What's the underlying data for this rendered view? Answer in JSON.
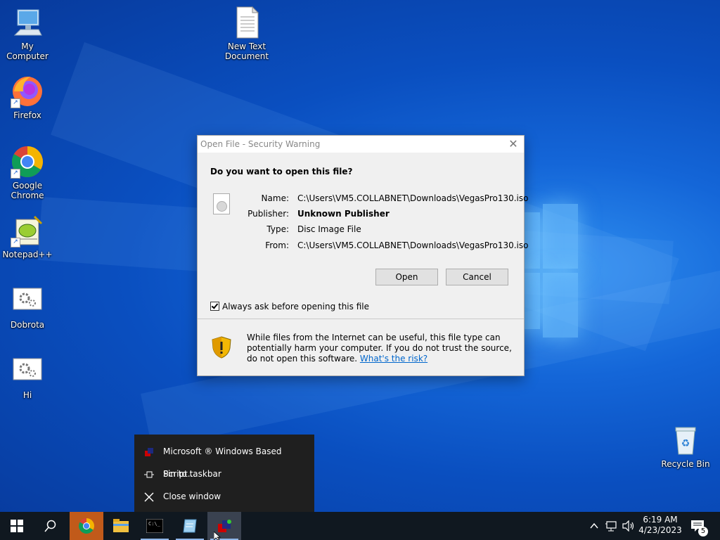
{
  "desktop": {
    "icons": [
      {
        "label": "My Computer"
      },
      {
        "label": "New Text Document"
      },
      {
        "label": "Firefox"
      },
      {
        "label": "Google Chrome"
      },
      {
        "label": "Notepad++"
      },
      {
        "label": "Dobrota"
      },
      {
        "label": "Hi"
      },
      {
        "label": "Recycle Bin"
      }
    ]
  },
  "dialog": {
    "title": "Open File - Security Warning",
    "close_glyph": "✕",
    "question": "Do you want to open this file?",
    "fields": [
      {
        "key": "Name:",
        "value": "C:\\Users\\VM5.COLLABNET\\Downloads\\VegasPro130.iso"
      },
      {
        "key": "Publisher:",
        "value": "Unknown Publisher"
      },
      {
        "key": "Type:",
        "value": "Disc Image File"
      },
      {
        "key": "From:",
        "value": "C:\\Users\\VM5.COLLABNET\\Downloads\\VegasPro130.iso"
      }
    ],
    "open_label": "Open",
    "cancel_label": "Cancel",
    "checkbox_label": "Always ask before opening this file",
    "checkbox_checked": true,
    "warning_text": "While files from the Internet can be useful, this file type can potentially harm your computer. If you do not trust the source, do not open this software.",
    "risk_link": "What's the risk?"
  },
  "jump_list": {
    "items": [
      {
        "label": "Microsoft ® Windows Based Script...",
        "icon": "script-host-icon"
      },
      {
        "label": "Pin to taskbar",
        "icon": "pin-icon"
      },
      {
        "label": "Close window",
        "icon": "close-icon"
      }
    ]
  },
  "taskbar": {
    "clock_time": "6:19 AM",
    "clock_date": "4/23/2023",
    "notification_count": "5",
    "apps": [
      "start-icon",
      "search-icon",
      "chrome-icon",
      "file-explorer-icon",
      "command-prompt-icon",
      "notepad-icon",
      "script-host-icon"
    ]
  },
  "colors": {
    "desktop_blue": "#0a4fc0",
    "taskbar": "#101820",
    "link": "#0066cc"
  }
}
